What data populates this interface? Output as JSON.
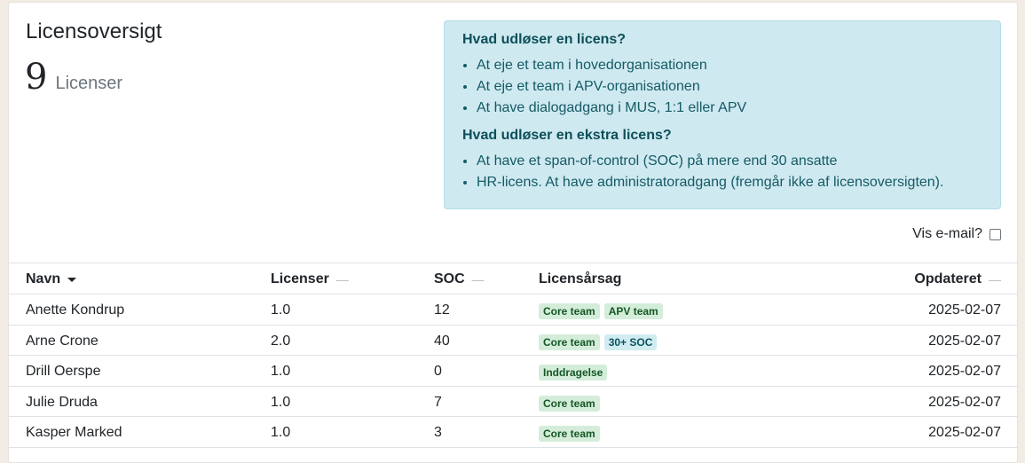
{
  "header": {
    "title": "Licensoversigt",
    "count": "9",
    "count_label": "Licenser"
  },
  "info": {
    "heading1": "Hvad udløser en licens?",
    "items1": [
      "At eje et team i hovedorganisationen",
      "At eje et team i APV-organisationen",
      "At have dialogadgang i MUS, 1:1 eller APV"
    ],
    "heading2": "Hvad udløser en ekstra licens?",
    "items2": [
      "At have et span-of-control (SOC) på mere end 30 ansatte",
      "HR-licens. At have administratoradgang (fremgår ikke af licensoversigten)."
    ]
  },
  "email_toggle": {
    "label": "Vis e-mail?",
    "checked": false
  },
  "table": {
    "columns": [
      "Navn",
      "Licenser",
      "SOC",
      "Licensårsag",
      "Opdateret"
    ],
    "sort_marker": "—",
    "rows": [
      {
        "name": "Anette Kondrup",
        "licenses": "1.0",
        "soc": "12",
        "badges": [
          "Core team",
          "APV team"
        ],
        "updated": "2025-02-07"
      },
      {
        "name": "Arne Crone",
        "licenses": "2.0",
        "soc": "40",
        "badges": [
          "Core team",
          "30+ SOC"
        ],
        "updated": "2025-02-07"
      },
      {
        "name": "Drill Oerspe",
        "licenses": "1.0",
        "soc": "0",
        "badges": [
          "Inddragelse"
        ],
        "updated": "2025-02-07"
      },
      {
        "name": "Julie Druda",
        "licenses": "1.0",
        "soc": "7",
        "badges": [
          "Core team"
        ],
        "updated": "2025-02-07"
      },
      {
        "name": "Kasper Marked",
        "licenses": "1.0",
        "soc": "3",
        "badges": [
          "Core team"
        ],
        "updated": "2025-02-07"
      }
    ]
  },
  "colors": {
    "info_bg": "#cfe9f0",
    "badge_green": "#d4edda",
    "badge_blue": "#d1ecf1"
  },
  "icons": {
    "sort_active": "caret-down-icon",
    "sort_inactive": "dash-icon"
  }
}
